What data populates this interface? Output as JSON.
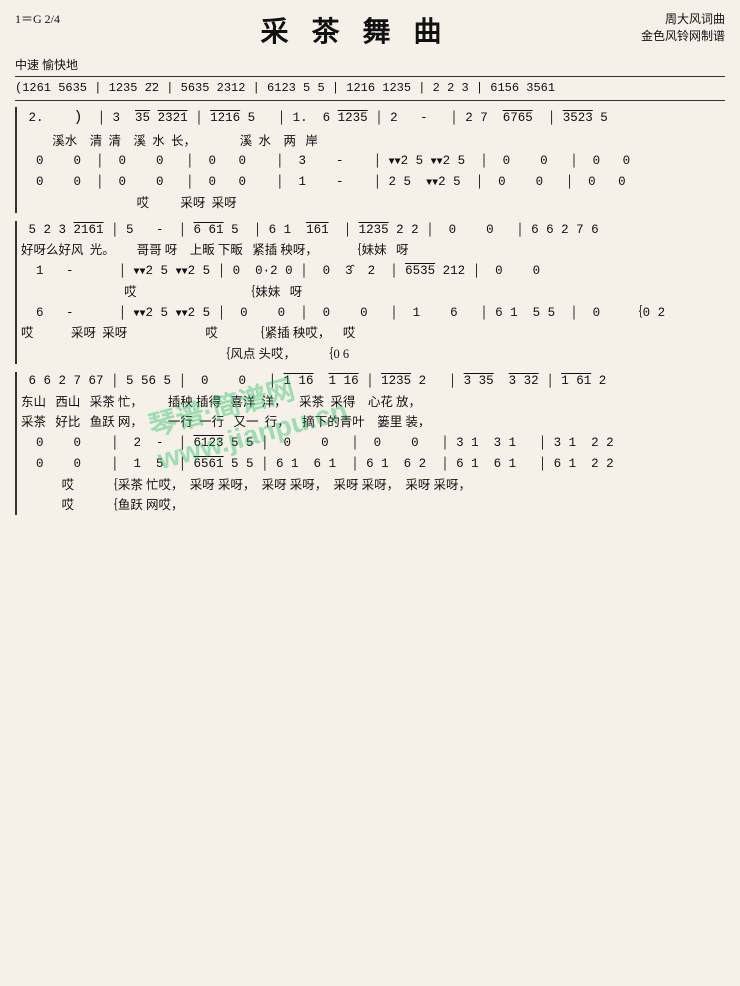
{
  "title": "采 茶 舞 曲",
  "composer_info": "周大风词曲",
  "arranger_info": "金色风铃网制谱",
  "tempo_key": "1＝G  2/4",
  "tempo_mark": "中速  愉快地",
  "intro": "(1261 5635 | 1235 2̈2 | 5635 2312 | 6123 5 5 | 1216 1235 | 2 2 3 | 6156 3561",
  "watermark": "琴谱 简谱网\nwww.jianpu.cn",
  "sections": [
    {
      "id": "s1",
      "rows": [
        {
          "notes": "2.    2) | 3 35 2321  | 1216 5    | 1. 6 1235  | 2  -    | 2 7  6765  | 3523 5",
          "lyrics": "         溪水    清  清   溪  水  长，         溪  水   两   岸"
        },
        {
          "notes": " 0    0  | 0    0    | 0   0     | 3   -     | 2̈5 2̈5   | 0    0    | 0   0",
          "lyrics": ""
        },
        {
          "notes": " 0    0  | 0    0    | 0   0     | 1   -     | 2 5  2̈5  | 0    0    | 0   0",
          "lyrics": "                                   哎         采呀 采呀"
        }
      ]
    },
    {
      "id": "s2",
      "rows": [
        {
          "notes": "5 2 3 2161 | 5  -   | 6 61 5   | 6 1  161  | 1235 2 2  | 0   0    | 6 6 2 7 6",
          "lyrics": "好呀么好风  光。      哥哥 呀    上畈 下畈  紧插 秧呀，          {妹妹   呀"
        },
        {
          "notes": " 1  -     | 2̈5 2̈5  | 0  0̂2 0  | 0  3̂  2  | 6535 212  | 0   0",
          "lyrics": "                              哎                              {妹妹   呀"
        },
        {
          "notes": " 6  -     | 2̈5 2̈5  | 0    0    | 0   0     | 1   6     | 6 1  5 5 | 0     {0 2",
          "lyrics": "哎          采呀 采呀                        哎          {紧插 秧哎，    哎  {0 6"
        },
        {
          "notes": "",
          "lyrics": "                                                              {风点 头哎，"
        }
      ]
    },
    {
      "id": "s3",
      "rows": [
        {
          "notes": "6 6 2 7 67 | 5 56 5  | 0   0    | 1 16  1 16 | 1235 2   | 3 35  3 32 | 1 61 2",
          "lyrics": "东山  西山   采茶 忙，         插秧 插得  喜洋  洋，    采茶  采得   心花 放，"
        },
        {
          "notes": "采茶  好比   鱼跃 网，         一行  一行  又一  行，    摘下的青叶   篓里 装，",
          "lyrics": ""
        },
        {
          "notes": " 0   0     | 2  -    | 6123 5 5 | 0    0    | 0    0    | 3 1  3 1   | 3 1  2 2",
          "lyrics": ""
        },
        {
          "notes": " 0   0     | 1  5    | 6561 5 5 | 6 1  6 1  | 6 1  6 2  | 6 1  6 1   | 6 1  2 2",
          "lyrics": "            哎          {采茶 忙哎，  采呀 采呀，  采呀 采呀，  采呀 采呀，  采呀 采呀，"
        },
        {
          "notes": "",
          "lyrics": "            哎          {鱼跃 网哎，"
        }
      ]
    }
  ]
}
